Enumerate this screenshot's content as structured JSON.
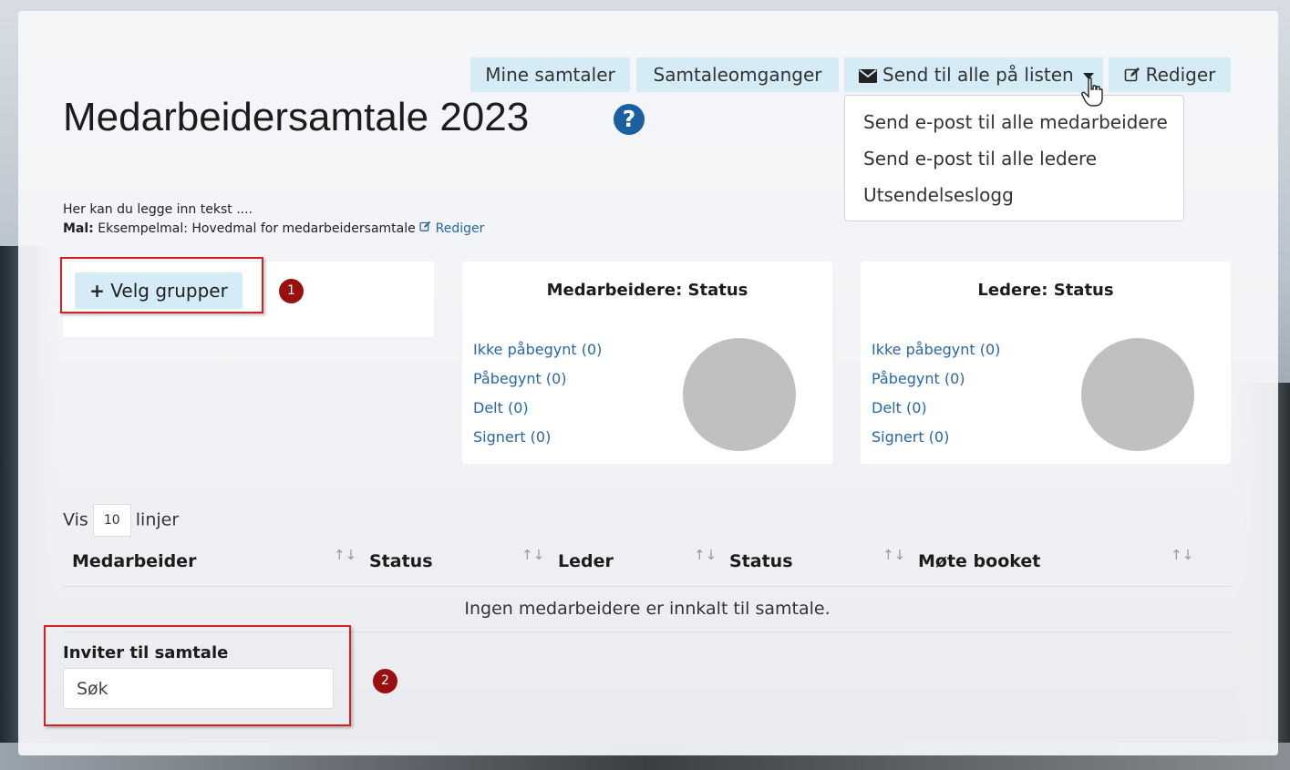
{
  "toolbar": {
    "mine_samtaler": "Mine samtaler",
    "samtaleomganger": "Samtaleomganger",
    "send_til_alle": "Send til alle på listen",
    "rediger": "Rediger"
  },
  "dropdown": {
    "items": [
      "Send e-post til alle medarbeidere",
      "Send e-post til alle ledere",
      "Utsendelseslogg"
    ]
  },
  "page": {
    "title": "Medarbeidersamtale 2023",
    "help_glyph": "?",
    "description": "Her kan du legge inn tekst ....",
    "mal_label": "Mal:",
    "mal_value": "Eksempelmal: Hovedmal for medarbeidersamtale",
    "mal_edit": "Rediger"
  },
  "groups": {
    "button_label": "Velg grupper",
    "marker": "1"
  },
  "medarbeidere_status": {
    "title": "Medarbeidere: Status",
    "items": [
      "Ikke påbegynt (0)",
      "Påbegynt (0)",
      "Delt (0)",
      "Signert (0)"
    ]
  },
  "ledere_status": {
    "title": "Ledere: Status",
    "items": [
      "Ikke påbegynt (0)",
      "Påbegynt (0)",
      "Delt (0)",
      "Signert (0)"
    ]
  },
  "table": {
    "show_prefix": "Vis",
    "show_count": "10",
    "show_suffix": "linjer",
    "columns": [
      "Medarbeider",
      "Status",
      "Leder",
      "Status",
      "Møte booket"
    ],
    "empty_message": "Ingen medarbeidere er innkalt til samtale."
  },
  "invite": {
    "label": "Inviter til samtale",
    "placeholder": "Søk",
    "marker": "2"
  },
  "colors": {
    "button_bg": "#d5ecf6",
    "link": "#2866a8",
    "highlight_border": "#d32020",
    "marker_bg": "#9a1010",
    "help_icon": "#1a5fa0",
    "pie_empty": "#c0c0c0"
  }
}
